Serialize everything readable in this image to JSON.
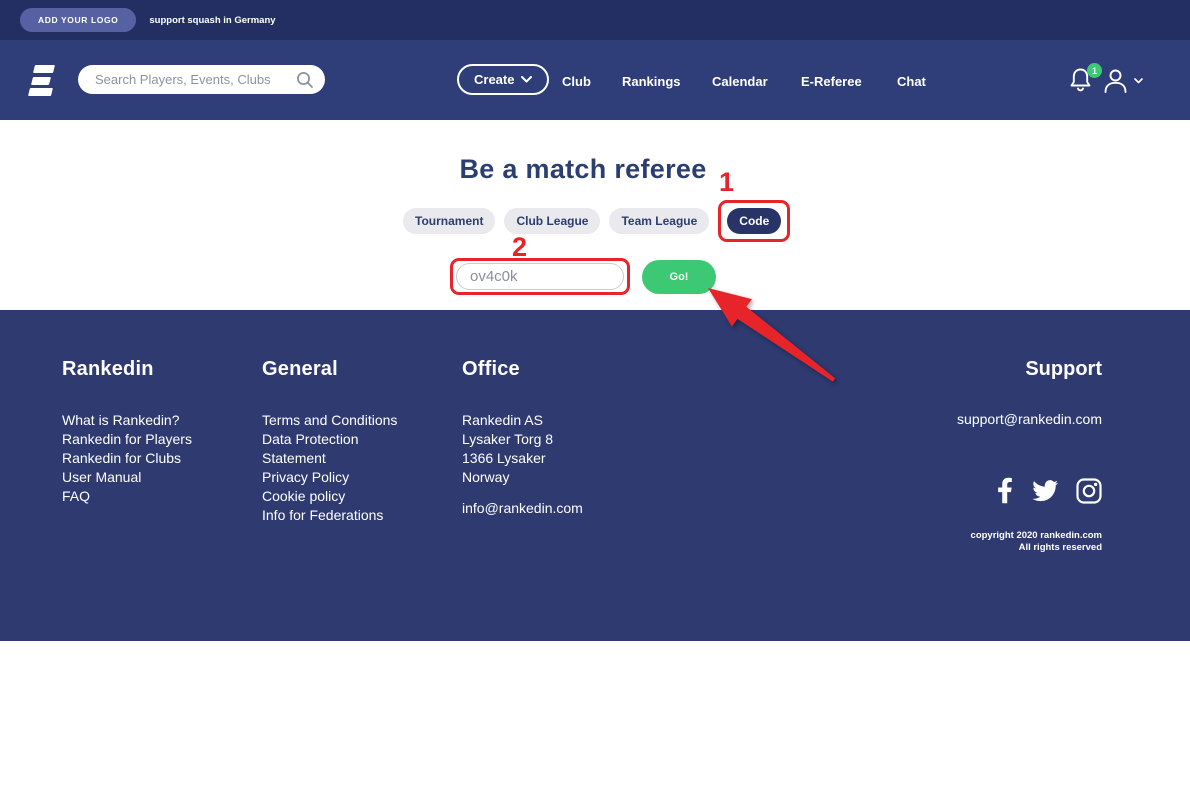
{
  "topbar": {
    "logo_button_label": "ADD YOUR LOGO",
    "tagline": "support squash in Germany"
  },
  "nav": {
    "search_placeholder": "Search Players, Events, Clubs",
    "create_label": "Create",
    "links": [
      {
        "label": "Club"
      },
      {
        "label": "Rankings"
      },
      {
        "label": "Calendar"
      },
      {
        "label": "E-Referee"
      },
      {
        "label": "Chat"
      }
    ],
    "notification_count": "1"
  },
  "main": {
    "title": "Be a match referee",
    "tabs": [
      {
        "label": "Tournament",
        "active": false
      },
      {
        "label": "Club League",
        "active": false
      },
      {
        "label": "Team League",
        "active": false
      },
      {
        "label": "Code",
        "active": true
      }
    ],
    "code_value": "ov4c0k",
    "go_label": "Go!",
    "annotations": {
      "step_1": "1",
      "step_2": "2"
    }
  },
  "footer": {
    "columns": [
      {
        "heading": "Rankedin",
        "links": [
          "What is Rankedin?",
          "Rankedin for Players",
          "Rankedin for Clubs",
          "User Manual",
          "FAQ"
        ]
      },
      {
        "heading": "General",
        "links": [
          "Terms and Conditions",
          "Data Protection Statement",
          "Privacy Policy",
          "Cookie policy",
          "Info for Federations"
        ]
      },
      {
        "heading": "Office",
        "address_lines": [
          "Rankedin AS",
          "Lysaker Torg 8",
          "1366 Lysaker",
          "Norway"
        ],
        "email": "info@rankedin.com"
      }
    ],
    "support": {
      "heading": "Support",
      "email": "support@rankedin.com",
      "social_icons": [
        "facebook",
        "twitter",
        "instagram"
      ],
      "copyright_line_1": "copyright 2020 rankedin.com",
      "copyright_line_2": "All rights reserved"
    }
  },
  "colors": {
    "topbar_bg": "#232F62",
    "navbar_bg": "#2F3D78",
    "footer_bg": "#2E3A70",
    "accent_green": "#3DC873",
    "annotation_red": "#E8242B",
    "active_tab_navy": "#283467",
    "heading_navy": "#2C3E70"
  }
}
